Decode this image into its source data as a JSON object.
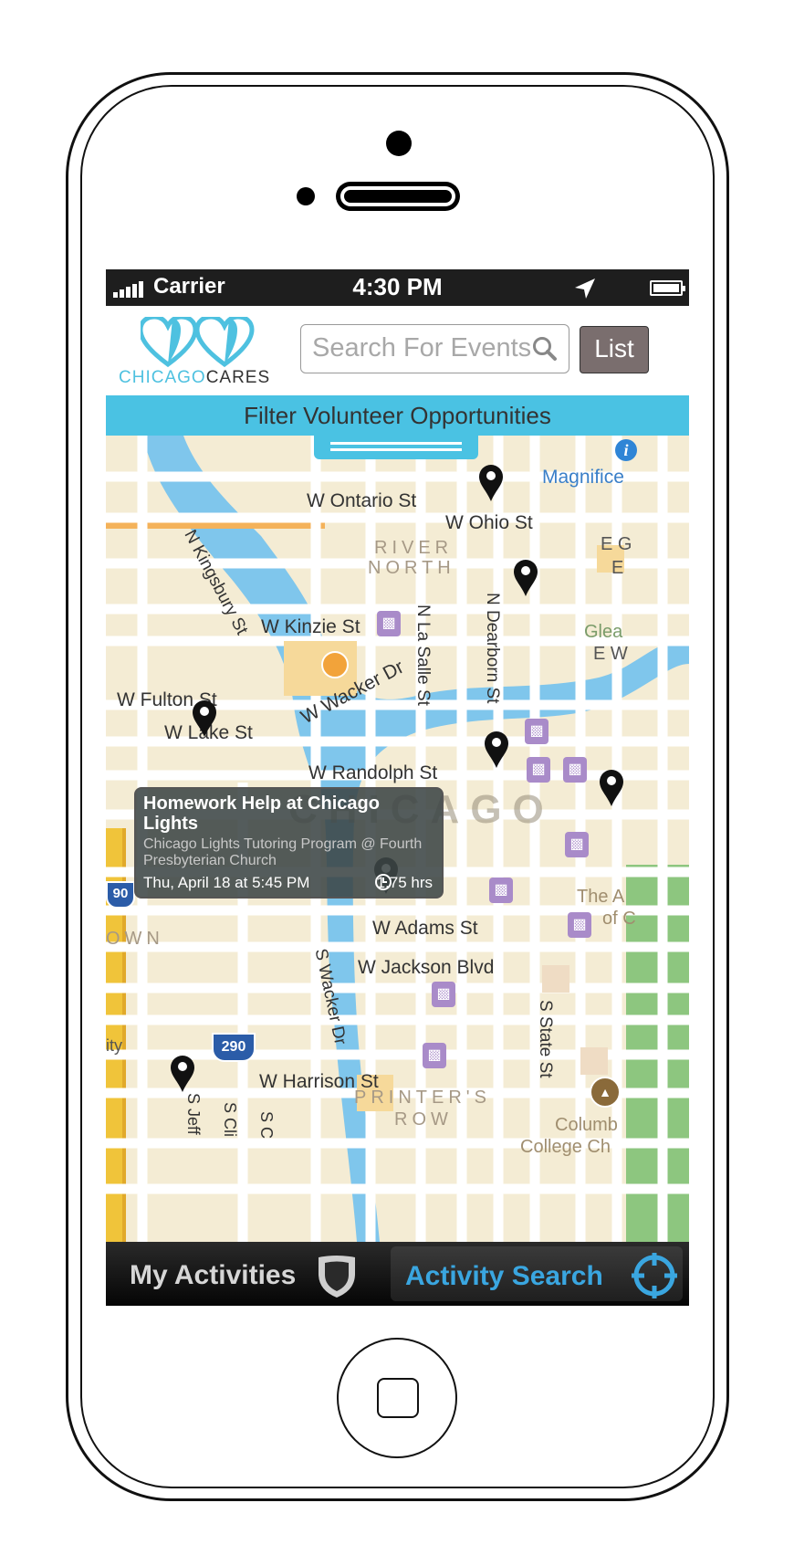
{
  "status_bar": {
    "carrier": "Carrier",
    "time": "4:30 PM"
  },
  "header": {
    "logo_left": "CHICAGO",
    "logo_right": "CARES",
    "search_placeholder": "Search For Events",
    "list_label": "List"
  },
  "filter": {
    "label": "Filter Volunteer Opportunities"
  },
  "map": {
    "streets": [
      "W Ontario St",
      "W Ohio St",
      "N Kingsbury St",
      "W Kinzie St",
      "N La Salle St",
      "N Dearborn St",
      "W Wacker Dr",
      "W Fulton St",
      "W Lake St",
      "W Randolph St",
      "W Adams St",
      "W Jackson Blvd",
      "S Wacker Dr",
      "S State St",
      "W Harrison St",
      "S Jeff",
      "S Cli",
      "S C"
    ],
    "neighborhoods": [
      "RIVER",
      "NORTH",
      "CHICAGO",
      "PRINTER'S",
      "ROW",
      "OWN"
    ],
    "places": [
      "Magnifice",
      "E G",
      "E",
      "Glea",
      "E W",
      "The A",
      "of C",
      "Columb",
      "College Ch",
      "ity"
    ],
    "highway_shields": [
      "90",
      "290"
    ]
  },
  "popup": {
    "title": "Homework Help at Chicago Lights",
    "subtitle": "Chicago Lights Tutoring Program @ Fourth Presbyterian Church",
    "date": "Thu, April 18 at 5:45 PM",
    "duration": "1.75 hrs"
  },
  "tabs": {
    "my_activities": "My Activities",
    "activity_search": "Activity Search"
  },
  "colors": {
    "brand_blue": "#4ac2e3",
    "tab_active": "#3aa6e0",
    "transit_purple": "#a98bc9"
  }
}
